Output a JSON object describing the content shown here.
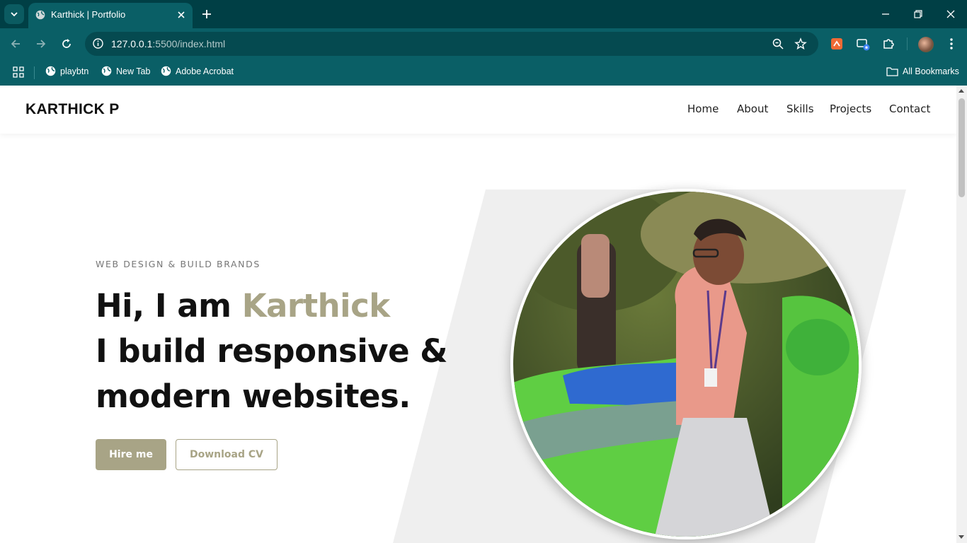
{
  "browser": {
    "tab_title": "Karthick | Portfolio",
    "url_host": "127.0.0.1",
    "url_path": ":5500/index.html",
    "bookmarks": [
      {
        "label": "playbtn",
        "icon": "globe-icon"
      },
      {
        "label": "New Tab",
        "icon": "globe-icon"
      },
      {
        "label": "Adobe Acrobat",
        "icon": "globe-icon"
      }
    ],
    "all_bookmarks_label": "All Bookmarks",
    "theme_color": "#0a5f66"
  },
  "site": {
    "logo": "KARTHICK P",
    "nav": [
      "Home",
      "About",
      "Skills",
      "Projects",
      "Contact"
    ],
    "eyebrow": "WEB DESIGN & BUILD BRANDS",
    "headline_prefix": "Hi, I am ",
    "headline_name": "Karthick",
    "headline_line2": "I build responsive &",
    "headline_line3": "modern websites.",
    "hire_label": "Hire me",
    "cv_label": "Download CV",
    "accent_color": "#a8a486"
  }
}
